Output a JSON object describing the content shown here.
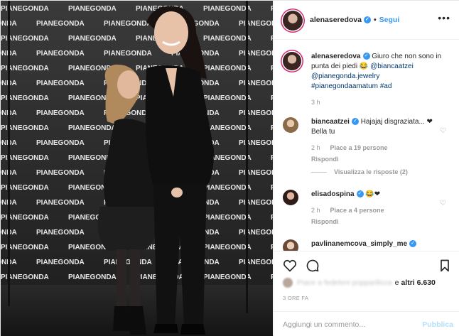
{
  "colors": {
    "link_blue": "#3897f0",
    "story_ring": "#d62976",
    "meta_gray": "#999999",
    "publish_disabled": "#b2dffc"
  },
  "backdrop": {
    "brand_text": "PIANEGONDA"
  },
  "header": {
    "username": "alenaseredova",
    "separator": "•",
    "follow_label": "Segui",
    "more_icon": "ellipsis-icon",
    "more_glyph": "•••"
  },
  "caption": {
    "username": "alenaseredova",
    "text": "Giuro che non sono in punta dei piedi 😂",
    "mention1": "@biancaatzei",
    "mention2": "@pianegonda.jewelry",
    "hashtags": "#pianegondaamatum #ad",
    "time": "3 h"
  },
  "comments": [
    {
      "username": "biancaatzei",
      "text": "Hajajaj disgraziata... ❤ Bella tu",
      "time": "2 h",
      "likes": "Piace a 19 persone",
      "reply": "Rispondi",
      "view_replies": "Visualizza le risposte (2)"
    },
    {
      "username": "elisadospina",
      "text": "😂❤",
      "time": "2 h",
      "likes": "Piace a 4 persone",
      "reply": "Rispondi"
    },
    {
      "username": "pavlinanemcova_simply_me",
      "text": ""
    }
  ],
  "actions": {
    "like_icon": "heart-icon",
    "comment_icon": "comment-icon",
    "save_icon": "bookmark-icon"
  },
  "likes_line": {
    "blurred": "Piace a fedeleni popparilicca",
    "connector": "e",
    "others": "altri 6.630"
  },
  "post_time": "3 ORE FA",
  "add_comment": {
    "placeholder": "Aggiungi un commento...",
    "publish_label": "Pubblica"
  }
}
